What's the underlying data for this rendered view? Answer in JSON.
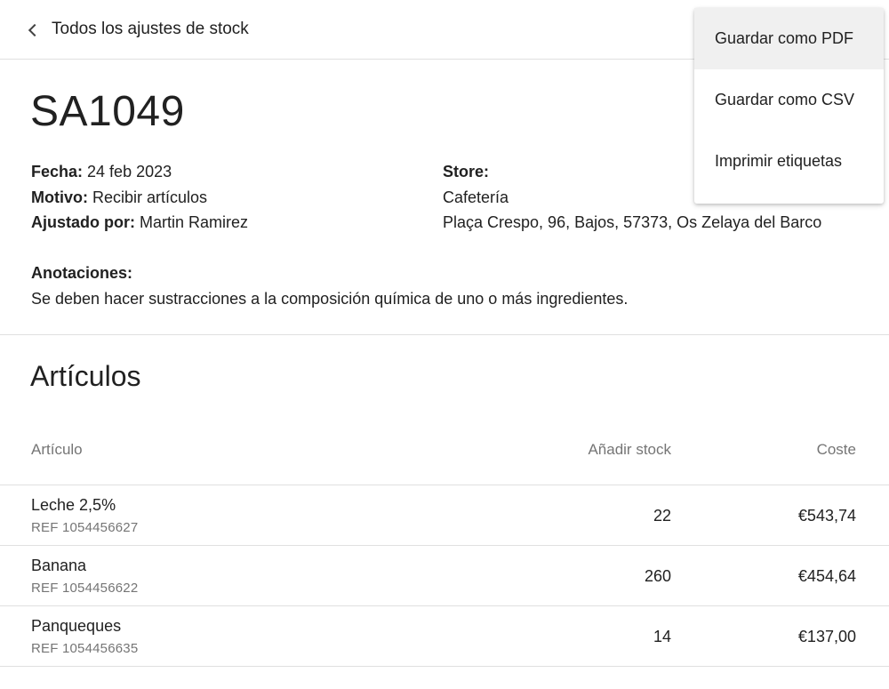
{
  "header": {
    "back_label": "Todos los ajustes de stock"
  },
  "adjustment": {
    "id": "SA1049",
    "date_label": "Fecha:",
    "date_value": " 24 feb 2023",
    "reason_label": "Motivo:",
    "reason_value": " Recibir artículos",
    "adjusted_by_label": "Ajustado por:",
    "adjusted_by_value": " Martin Ramirez",
    "store_label": "Store:",
    "store_name": "Cafetería",
    "store_address": "Plaça Crespo, 96, Bajos, 57373, Os Zelaya del Barco",
    "notes_label": "Anotaciones:",
    "notes_value": "Se deben hacer sustracciones a la composición química de uno o más ingredientes."
  },
  "items_section": {
    "title": "Artículos",
    "columns": {
      "item": "Artículo",
      "add_stock": "Añadir stock",
      "cost": "Coste"
    },
    "rows": [
      {
        "name": "Leche 2,5%",
        "ref": "REF 1054456627",
        "add_stock": "22",
        "cost": "€543,74"
      },
      {
        "name": "Banana",
        "ref": "REF 1054456622",
        "add_stock": "260",
        "cost": "€454,64"
      },
      {
        "name": "Panqueques",
        "ref": "REF 1054456635",
        "add_stock": "14",
        "cost": "€137,00"
      }
    ]
  },
  "menu": {
    "items": [
      {
        "label": "Guardar como PDF"
      },
      {
        "label": "Guardar como CSV"
      },
      {
        "label": "Imprimir etiquetas"
      }
    ]
  }
}
